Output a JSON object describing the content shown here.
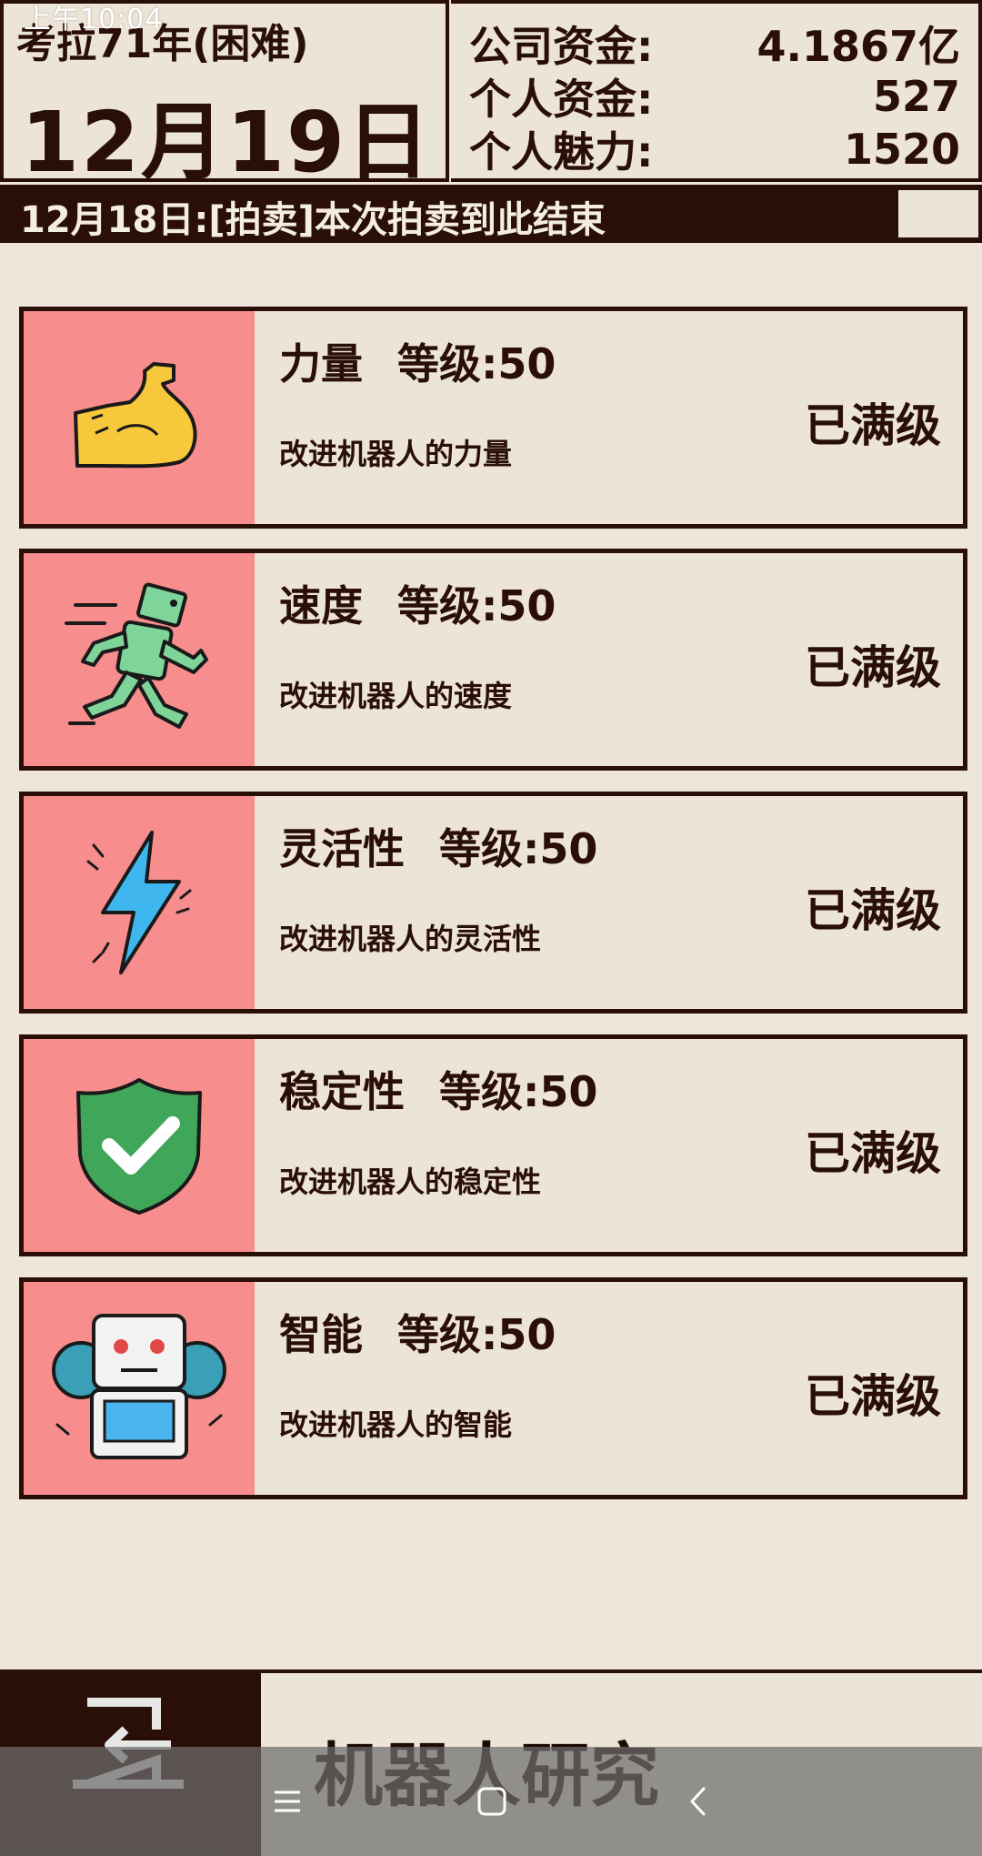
{
  "status_bar": {
    "time": "上午10:04"
  },
  "header": {
    "year": "考拉71年(困难)",
    "date": "12月19日",
    "stats": [
      {
        "label": "公司资金:",
        "value": "4.1867亿"
      },
      {
        "label": "个人资金:",
        "value": "527"
      },
      {
        "label": "个人魅力:",
        "value": "1520"
      }
    ]
  },
  "log": {
    "text": "12月18日:[拍卖]本次拍卖到此结束"
  },
  "research_items": [
    {
      "name": "力量",
      "level": "等级:50",
      "description": "改进机器人的力量",
      "status": "已满级",
      "icon": "flexed-arm-icon"
    },
    {
      "name": "速度",
      "level": "等级:50",
      "description": "改进机器人的速度",
      "status": "已满级",
      "icon": "running-robot-icon"
    },
    {
      "name": "灵活性",
      "level": "等级:50",
      "description": "改进机器人的灵活性",
      "status": "已满级",
      "icon": "lightning-bolt-icon"
    },
    {
      "name": "稳定性",
      "level": "等级:50",
      "description": "改进机器人的稳定性",
      "status": "已满级",
      "icon": "shield-check-icon"
    },
    {
      "name": "智能",
      "level": "等级:50",
      "description": "改进机器人的智能",
      "status": "已满级",
      "icon": "robot-gear-icon"
    }
  ],
  "page": {
    "title": "机器人研究"
  },
  "colors": {
    "dark": "#2a0f08",
    "background": "#ede6d9",
    "icon_panel": "#f78d8c"
  }
}
